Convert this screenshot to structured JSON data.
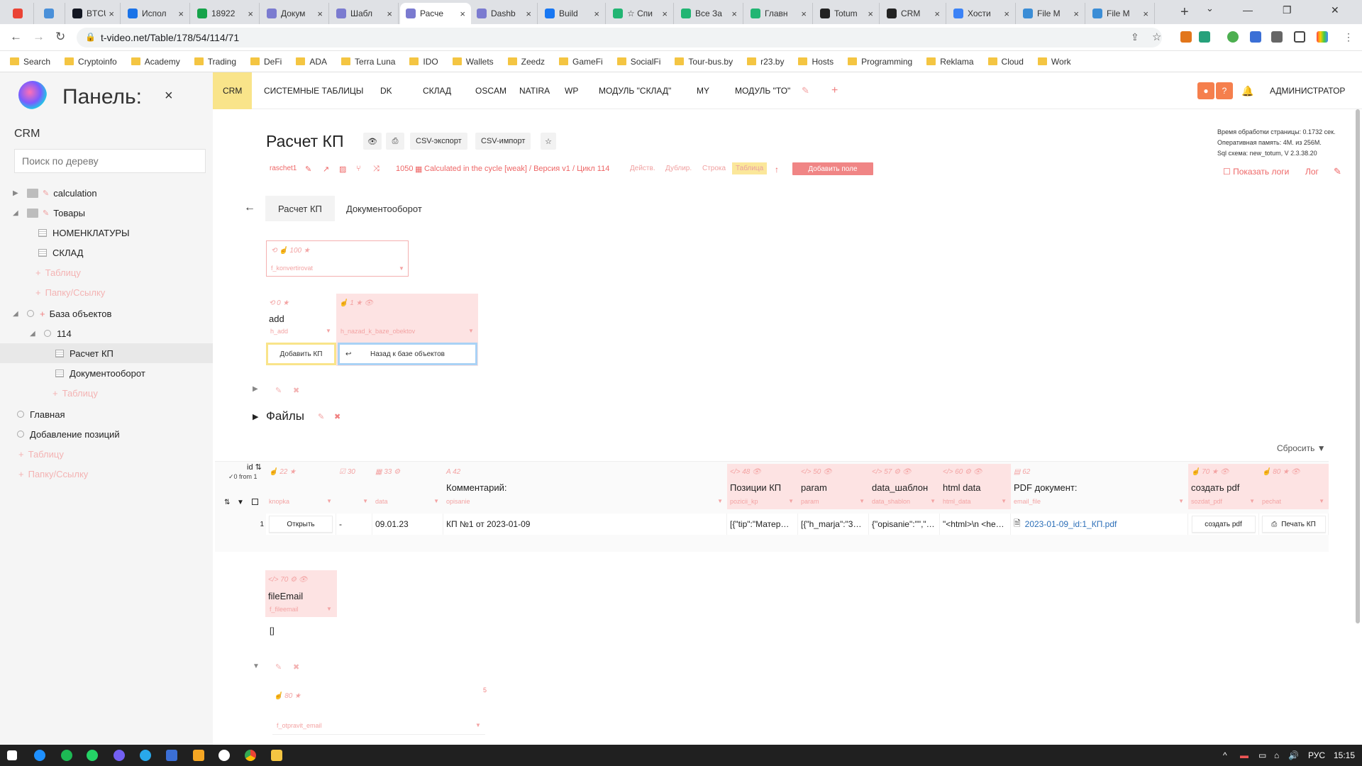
{
  "browser": {
    "tabs": [
      {
        "title": "",
        "color": "#ea4335"
      },
      {
        "title": "",
        "color": "#4a90d9"
      },
      {
        "title": "BTCUS",
        "color": "#131722"
      },
      {
        "title": "Испол",
        "color": "#1a73e8"
      },
      {
        "title": "18922",
        "color": "#16a34a"
      },
      {
        "title": "Докум",
        "color": "#7b7bd0"
      },
      {
        "title": "Шабл",
        "color": "#7b7bd0"
      },
      {
        "title": "Расче",
        "color": "#7b7bd0"
      },
      {
        "title": "Dashb",
        "color": "#7b7bd0"
      },
      {
        "title": "Build",
        "color": "#1877f2"
      },
      {
        "title": "☆ Спи",
        "color": "#22b573"
      },
      {
        "title": "Все За",
        "color": "#22b573"
      },
      {
        "title": "Главн",
        "color": "#22b573"
      },
      {
        "title": "Totum",
        "color": "#222222"
      },
      {
        "title": "CRM",
        "color": "#222222"
      },
      {
        "title": "Хости",
        "color": "#3b82f6"
      },
      {
        "title": "File M",
        "color": "#3b8dd6"
      },
      {
        "title": "File M",
        "color": "#3b8dd6"
      }
    ],
    "active_tab": 7,
    "url": "t-video.net/Table/178/54/114/71",
    "bookmarks": [
      "Search",
      "Cryptoinfo",
      "Academy",
      "Trading",
      "DeFi",
      "ADA",
      "Terra Luna",
      "IDO",
      "Wallets",
      "Zeedz",
      "GameFi",
      "SocialFi",
      "Tour-bus.by",
      "r23.by",
      "Hosts",
      "Programming",
      "Reklama",
      "Cloud",
      "Work"
    ]
  },
  "sidebar": {
    "title": "Панель:",
    "close": "×",
    "section": "CRM",
    "search_placeholder": "Поиск по дереву",
    "tree": [
      {
        "label": "calculation",
        "type": "folder",
        "depth": 0
      },
      {
        "label": "Товары",
        "type": "folder",
        "depth": 0,
        "open": true
      },
      {
        "label": "НОМЕНКЛАТУРЫ",
        "type": "table",
        "depth": 1
      },
      {
        "label": "СКЛАД",
        "type": "table",
        "depth": 1
      },
      {
        "label": "Таблицу",
        "type": "add",
        "depth": 1
      },
      {
        "label": "Папку/Ссылку",
        "type": "add",
        "depth": 1
      },
      {
        "label": "База объектов",
        "type": "node",
        "depth": 0,
        "open": true
      },
      {
        "label": "114",
        "type": "node",
        "depth": 1,
        "open": true
      },
      {
        "label": "Расчет КП",
        "type": "table",
        "depth": 2,
        "selected": true
      },
      {
        "label": "Документооборот",
        "type": "table",
        "depth": 2
      },
      {
        "label": "Таблицу",
        "type": "add",
        "depth": 2
      },
      {
        "label": "Главная",
        "type": "node",
        "depth": 0
      },
      {
        "label": "Добавление позиций",
        "type": "node",
        "depth": 0
      },
      {
        "label": "Таблицу",
        "type": "add",
        "depth": 0
      },
      {
        "label": "Папку/Ссылку",
        "type": "add",
        "depth": 0
      }
    ]
  },
  "topmenu": {
    "items": [
      "CRM",
      "СИСТЕМНЫЕ ТАБЛИЦЫ",
      "DK",
      "СКЛАД",
      "OSCAM",
      "NATIRA",
      "WP",
      "МОДУЛЬ \"СКЛАД\"",
      "MY",
      "МОДУЛЬ \"ТО\""
    ],
    "active": "CRM",
    "user": "АДМИНИСТРАТОР",
    "help": "?"
  },
  "stats": {
    "line1": "Время обработки страницы: 0.1732 сек.",
    "line2": "Оперативная память: 4M. из 256M.",
    "line3": "Sql схема: new_totum, V 2.3.38.20",
    "show_logs": "Показать логи",
    "log": "Лог"
  },
  "page": {
    "title": "Расчет КП",
    "buttons": [
      "CSV-экспорт",
      "CSV-импорт"
    ],
    "table_name": "raschet1",
    "cycle_info": "1050",
    "cycle_text": "Calculated in the cycle [weak] / Версия v1 / Цикл 114",
    "actions": [
      "Действ.",
      "Дублир.",
      "Строка",
      "Таблица"
    ],
    "add_field": "Добавить поле",
    "tabs": [
      "Расчет КП",
      "Документооборот"
    ],
    "active_tab": "Расчет КП"
  },
  "params": {
    "konvert": {
      "meta": "100",
      "field": "f_konvertirovat"
    },
    "add": {
      "meta": "0",
      "label": "add",
      "field": "h_add",
      "button": "Добавить КП"
    },
    "back": {
      "meta": "1",
      "field": "h_nazad_k_baze_obektov",
      "button": "Назад к базе объектов"
    },
    "section_files": "Файлы",
    "fileemail": {
      "meta": "70",
      "label": "fileEmail",
      "field": "f_fileemail",
      "value": "[]"
    },
    "otpravit": {
      "meta": "80",
      "field": "f_otpravit_email",
      "count": "5"
    }
  },
  "table": {
    "reset": "Сбросить",
    "id_label": "id",
    "row_count": "✓0 from 1",
    "columns": [
      {
        "num": "22",
        "label": "",
        "field": "knopka"
      },
      {
        "num": "30",
        "label": "",
        "field": ""
      },
      {
        "num": "33",
        "label": "",
        "field": "data"
      },
      {
        "num": "42",
        "label": "Комментарий:",
        "field": "opisanie"
      },
      {
        "num": "48",
        "label": "Позиции КП",
        "field": "pozicii_kp"
      },
      {
        "num": "50",
        "label": "param",
        "field": "param"
      },
      {
        "num": "57",
        "label": "data_шаблон",
        "field": "data_shablon"
      },
      {
        "num": "60",
        "label": "html data",
        "field": "html_data"
      },
      {
        "num": "62",
        "label": "PDF документ:",
        "field": "email_file"
      },
      {
        "num": "70",
        "label": "создать pdf",
        "field": "sozdat_pdf"
      },
      {
        "num": "80",
        "label": "",
        "field": "pechat"
      }
    ],
    "rows": [
      {
        "id": "1",
        "knopka": "Открыть",
        "c30": "-",
        "data": "09.01.23",
        "opisanie": "КП №1 от 2023-01-09",
        "pozicii": "[{\"tip\":\"Матер…",
        "param": "[{\"h_marja\":\"3…",
        "shablon": "{\"opisanie\":\"\",\"…",
        "html": "\"<html>\\n <he…",
        "pdf": "2023-01-09_id:1_КП.pdf",
        "sozdat": "создать pdf",
        "pechat": "Печать КП"
      }
    ]
  },
  "taskbar": {
    "lang": "РУС",
    "time": "15:15"
  },
  "colors": {
    "accent_yellow": "#f9e48a",
    "pink": "#f08585",
    "user_orange": "#f57f4d"
  }
}
